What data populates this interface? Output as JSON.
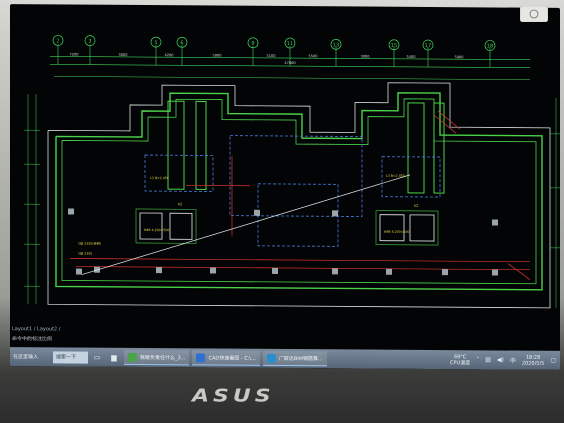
{
  "layout_tabs": "Layout1 / Layout2 /",
  "command_line": "命令中的标注比例",
  "taskbar": {
    "start_label": "在这里输入",
    "search_label": "搜索一下",
    "apps": [
      {
        "label": "我敢负责任什么_3...",
        "color": "#4aa347"
      },
      {
        "label": "CAD快速看图 - C:\\...",
        "color": "#2f6fd1"
      },
      {
        "label": "广联达BIM钢筋算...",
        "color": "#2a8fcf"
      }
    ],
    "temperature": "69°C",
    "cpu_label": "CPU温度",
    "time": "18:28",
    "date": "2020/5/5"
  },
  "cad": {
    "axis_labels": [
      "2",
      "3",
      "5",
      "6",
      "9",
      "11",
      "13",
      "15",
      "17",
      "18"
    ],
    "dims_top": [
      "7200",
      "3000",
      "4200",
      "5000",
      "5100",
      "5500",
      "3000",
      "5400",
      "5000"
    ],
    "overall_dim": "47000",
    "note_labels": [
      "KZ",
      "KZ",
      "6Φ8 4.200=500",
      "6Φ8 4.200=500",
      "L3 B=2.450",
      "L3 B=2.450",
      "1层 2350(参照)",
      "1层 2350"
    ]
  },
  "colors": {
    "axis_green": "#3ed65a",
    "wall_green": "#4cd24a",
    "beam_blue": "#4a7fe0",
    "dim_red": "#e0352f",
    "text_yellow": "#e6d34a",
    "white_line": "#e8eef2"
  },
  "brand": "ASUS"
}
